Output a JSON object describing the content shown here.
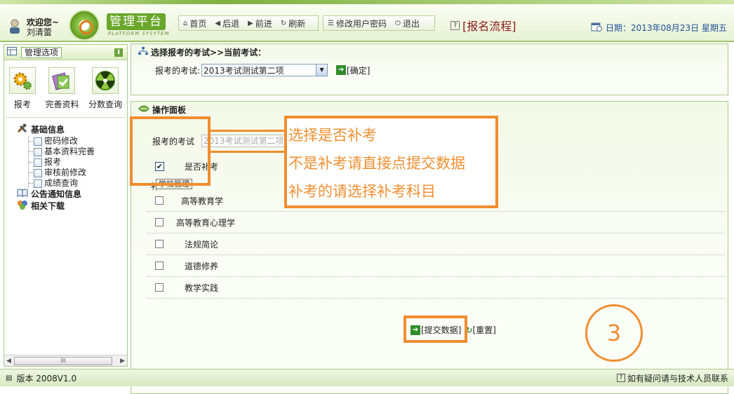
{
  "header": {
    "welcome_line1": "欢迎您~",
    "welcome_line2": "刘清蕾",
    "logo_title": "管理平台",
    "logo_sub": "PLATFORM SYSYTEM",
    "nav": [
      {
        "label": "首页",
        "icon": "home-icon"
      },
      {
        "label": "后退",
        "icon": "back-icon"
      },
      {
        "label": "前进",
        "icon": "forward-icon"
      },
      {
        "label": "刷新",
        "icon": "refresh-icon"
      }
    ],
    "change_password": "修改用户密码",
    "logout": "退出",
    "flow_link": "[报名流程]",
    "date": "日期：2013年08月23日 星期五",
    "accent": "#6aa72a"
  },
  "sidebar": {
    "header_label": "管理选项",
    "quick_icons": [
      {
        "label": "报考",
        "icon": "gear-icon"
      },
      {
        "label": "完善资料",
        "icon": "book-icon"
      },
      {
        "label": "分数查询",
        "icon": "radiation-icon"
      }
    ],
    "groups": [
      {
        "label": "基础信息",
        "children": [
          "密码修改",
          "基本资料完善",
          "报考",
          "审核前修改",
          "成绩查询"
        ]
      },
      {
        "label": "公告通知信息",
        "children": []
      },
      {
        "label": "相关下载",
        "children": []
      }
    ],
    "scroll_thumb": "III"
  },
  "select_panel": {
    "title": "选择报考的考试>>当前考试：",
    "label": "报考的考试:",
    "selected": "2013考试测试第二项",
    "confirm": "[确定]"
  },
  "op_panel": {
    "title": "操作面板",
    "exam_label": "报考的考试",
    "exam_value": "2013考试测试第二项",
    "makeup_label": "是否补考",
    "makeup_checked": "✔",
    "tooltip": "学校管理",
    "subject_title": "补",
    "subjects": [
      {
        "name": "高等教育学"
      },
      {
        "name": "高等教育心理学"
      },
      {
        "name": "法规简论"
      },
      {
        "name": "道德修养"
      },
      {
        "name": "教学实践"
      }
    ],
    "submit": "[提交数据]",
    "reset": "[重置]"
  },
  "annotations": {
    "callout": [
      "选择是否补考",
      "不是补考请直接点提交数据",
      "补考的请选择补考科目"
    ],
    "step": "3",
    "color": "#f08d2f"
  },
  "footer": {
    "version": "版本 2008V1.0",
    "contact": "如有疑问请与技术人员联系"
  }
}
